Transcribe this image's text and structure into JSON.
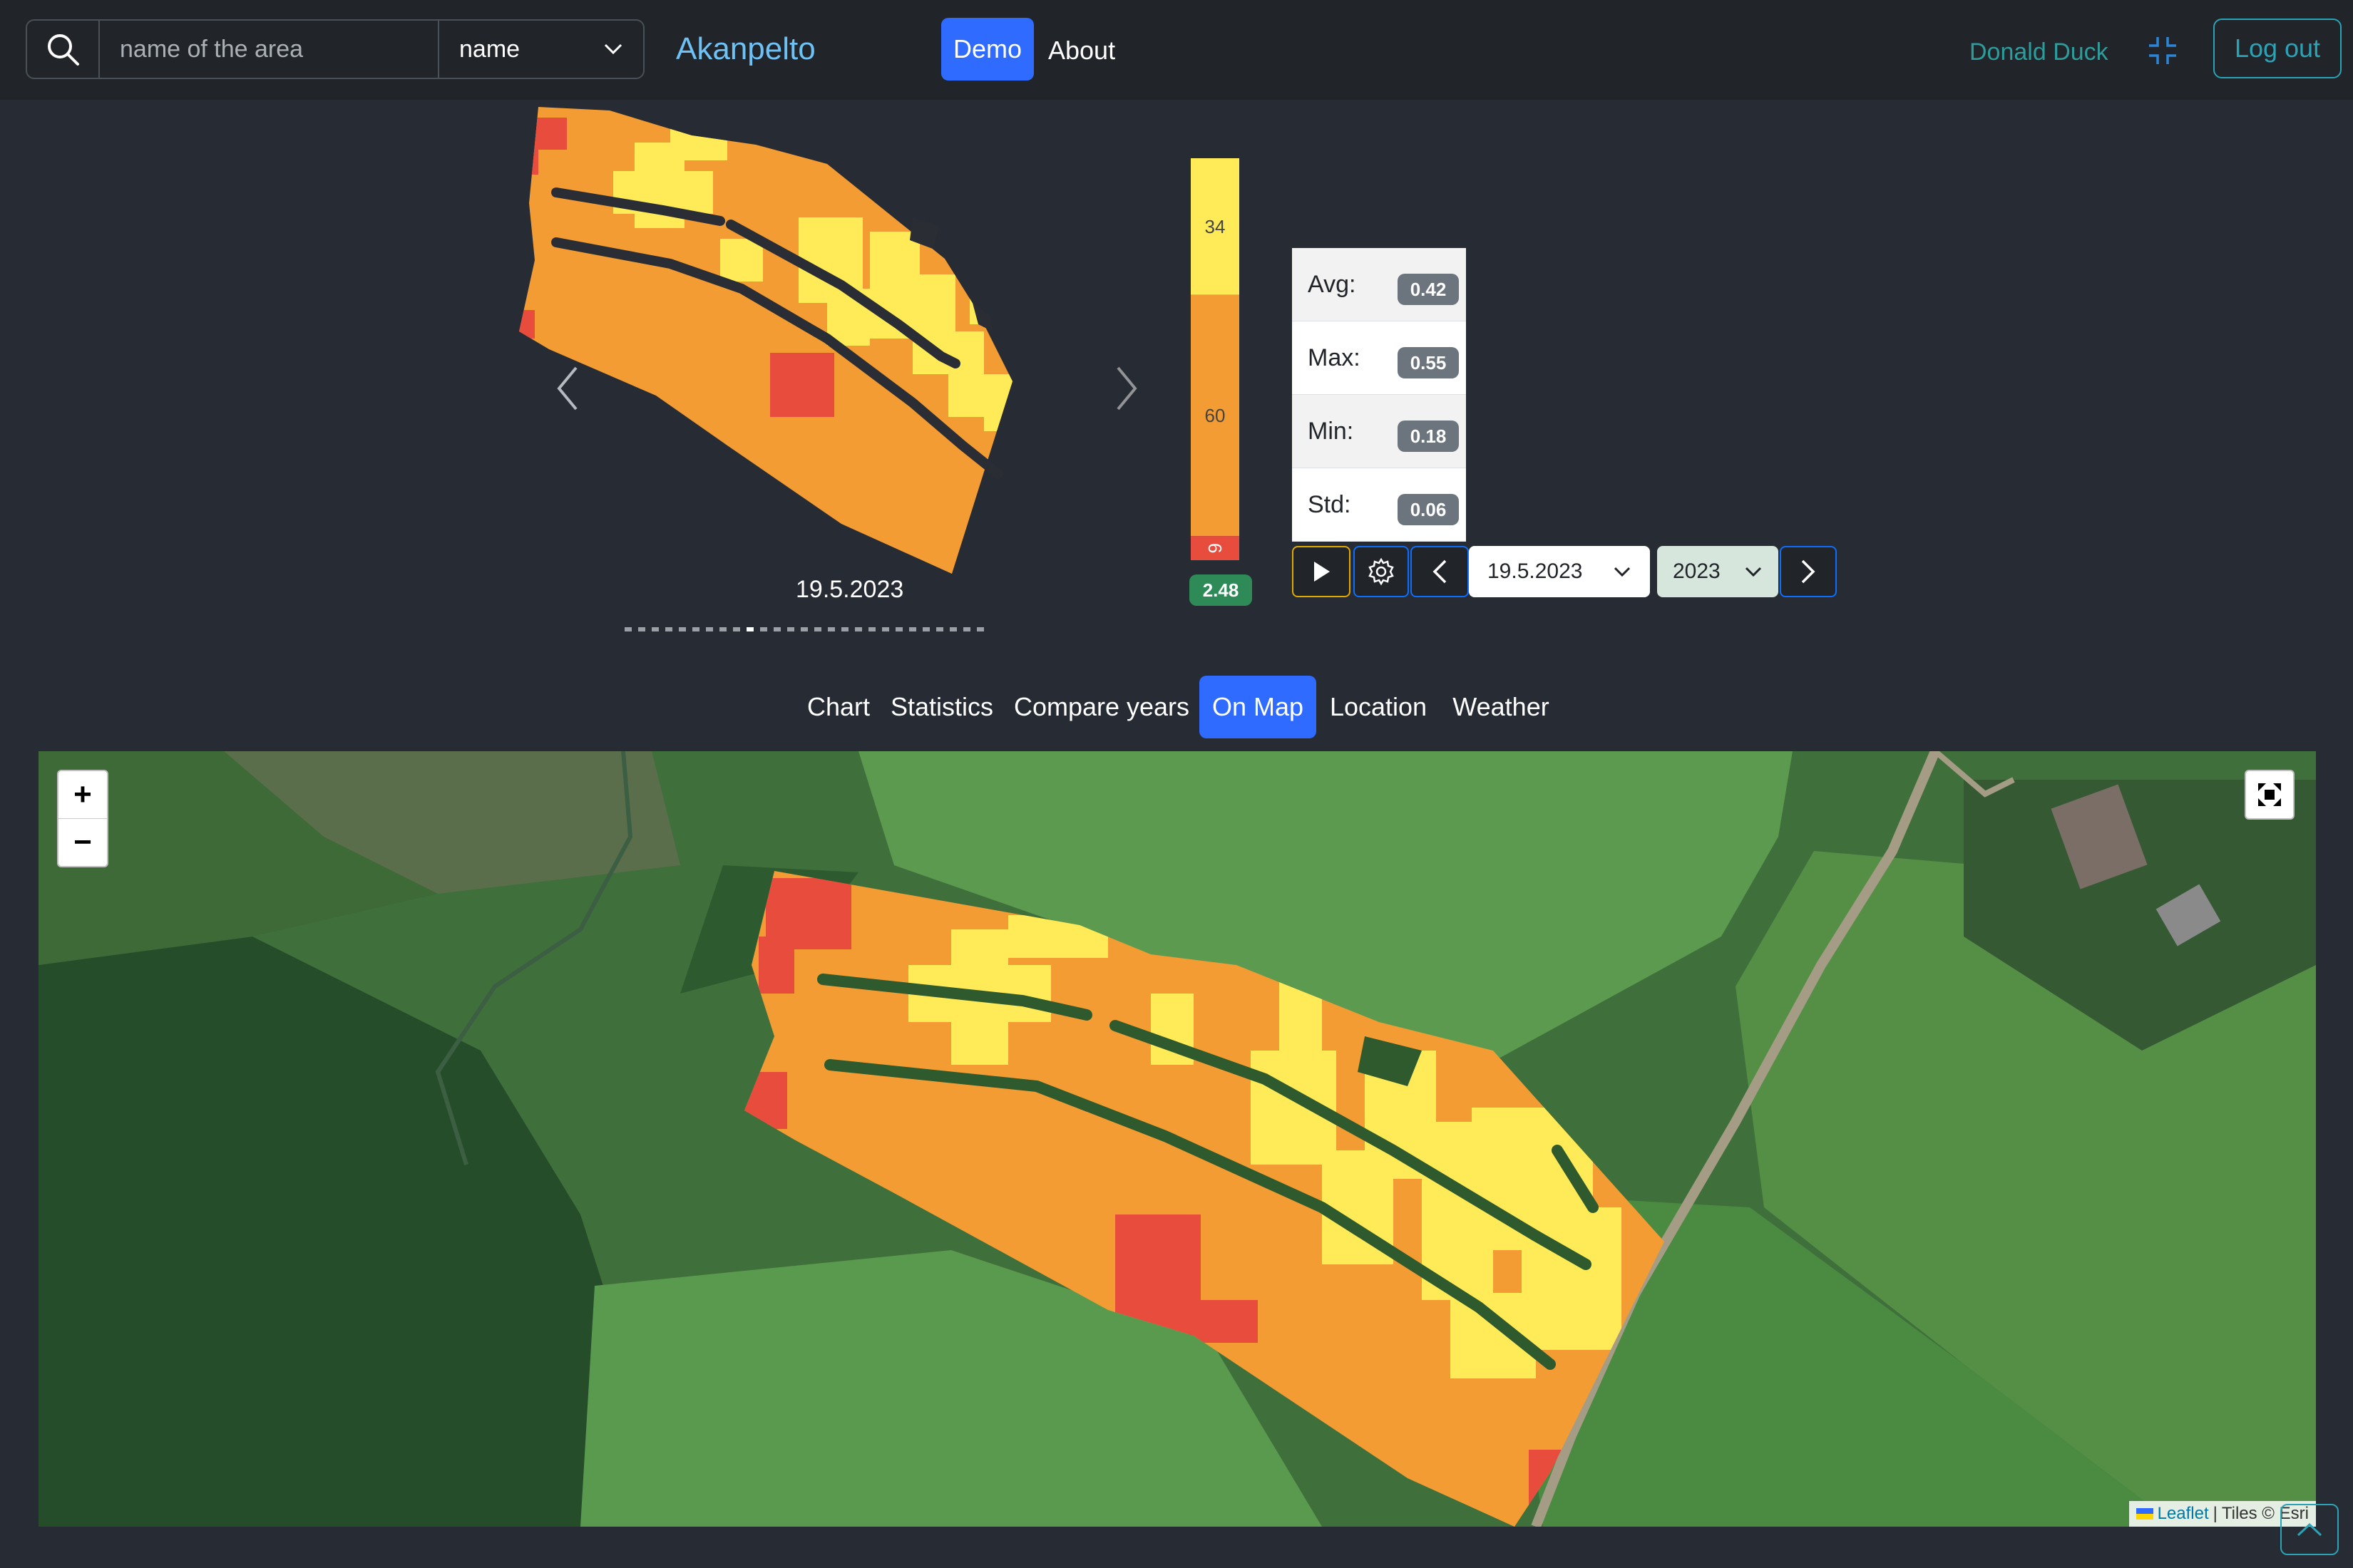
{
  "navbar": {
    "search_placeholder": "name of the area",
    "name_select": "name",
    "brand": "Akanpelto",
    "demo": "Demo",
    "about": "About",
    "user": "Donald Duck",
    "logout": "Log out"
  },
  "carousel": {
    "date": "19.5.2023",
    "slide_count": 27,
    "active_slide": 9
  },
  "legend": {
    "labels": [
      "34",
      "60",
      "6"
    ],
    "fractions": [
      0.34,
      0.6,
      0.06
    ],
    "colors": [
      "#ffeb57",
      "#f39c34",
      "#e74c3c"
    ],
    "badge": "2.48",
    "badge_color": "#2e8b57"
  },
  "stats": {
    "avg_label": "Avg:",
    "avg": "0.42",
    "max_label": "Max:",
    "max": "0.55",
    "min_label": "Min:",
    "min": "0.18",
    "std_label": "Std:",
    "std": "0.06"
  },
  "controls": {
    "date": "19.5.2023",
    "year": "2023"
  },
  "tabs": [
    "Chart",
    "Statistics",
    "Compare years",
    "On Map",
    "Location",
    "Weather"
  ],
  "active_tab": "On Map",
  "map": {
    "zoom_in": "+",
    "zoom_out": "−",
    "attribution_link": "Leaflet",
    "attribution_sep": "|",
    "attribution_tiles": "Tiles © Esri"
  },
  "colors": {
    "high": "#ffeb57",
    "mid": "#f39c34",
    "low": "#e74c3c",
    "accent": "#2f6bff"
  }
}
